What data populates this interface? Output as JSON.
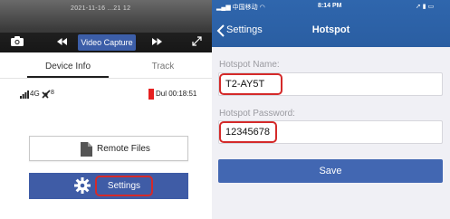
{
  "left_screen": {
    "video_osd": "2021-11-16 ...21 12",
    "video_capture_label": "Video Capture",
    "tabs": {
      "device_info": "Device Info",
      "track": "Track"
    },
    "status": {
      "network": "4G",
      "satellites": "8",
      "recording_time": "Dul 00:18:51",
      "recording_color": "#e62020"
    },
    "remote_files_label": "Remote Files",
    "settings_label": "Settings",
    "accent_color": "#3f5ca6",
    "highlight_color": "#d42a2a",
    "icons": [
      "camera-icon",
      "rewind-icon",
      "fast-forward-icon",
      "expand-icon",
      "signal-icon",
      "satellite-icon",
      "file-icon",
      "gear-icon"
    ]
  },
  "right_screen": {
    "status_bar": {
      "carrier": "中国移动",
      "time": "8:14 PM",
      "right_icons": "➚ ▮ ▭"
    },
    "nav": {
      "back_label": "Settings",
      "title": "Hotspot"
    },
    "hotspot_name_label": "Hotspot Name:",
    "hotspot_name_value": "T2-AY5T",
    "hotspot_password_label": "Hotspot Password:",
    "hotspot_password_value": "12345678",
    "save_label": "Save",
    "nav_color": "#2f66ad",
    "button_color": "#4267b2"
  }
}
